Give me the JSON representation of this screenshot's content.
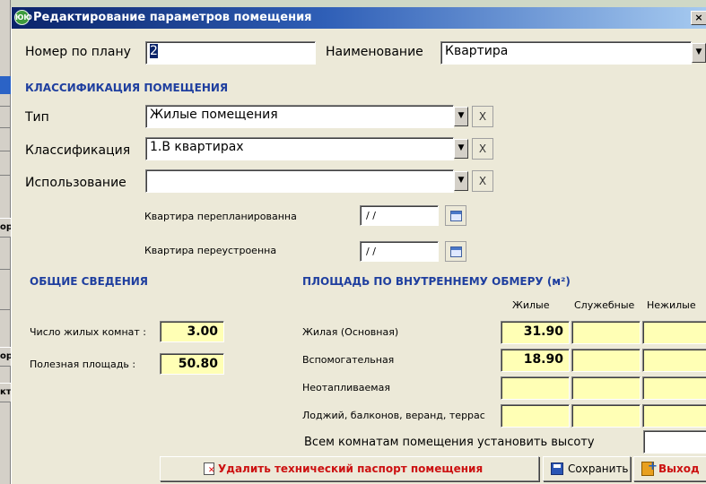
{
  "window": {
    "title": "Редактирование параметров помещения",
    "icon_text": "ЮЮ",
    "close_label": "×"
  },
  "left_fragments": [
    "ор",
    "ор",
    "кт"
  ],
  "plan_number": {
    "label": "Номер по плану",
    "value": "2"
  },
  "name": {
    "label": "Наименование",
    "value": "Квартира"
  },
  "classification_section": {
    "title": "КЛАССИФИКАЦИЯ ПОМЕЩЕНИЯ",
    "type": {
      "label": "Тип",
      "value": "Жилые помещения"
    },
    "classification": {
      "label": "Классификация",
      "value": "1.В квартирах"
    },
    "usage": {
      "label": "Использование",
      "value": ""
    },
    "clear_label": "X",
    "replanned": {
      "label": "Квартира перепланированна",
      "value": "/ /"
    },
    "rebuilt": {
      "label": "Квартира переустроенна",
      "value": "/ /"
    }
  },
  "general_section": {
    "title": "ОБЩИЕ СВЕДЕНИЯ",
    "rooms": {
      "label": "Число жилых комнат :",
      "value": "3.00"
    },
    "useful_area": {
      "label": "Полезная площадь :",
      "value": "50.80"
    }
  },
  "area_section": {
    "title": "ПЛОЩАДЬ ПО ВНУТРЕННЕМУ ОБМЕРУ (м²)",
    "columns": [
      "Жилые",
      "Служебные",
      "Нежилые"
    ],
    "rows": [
      {
        "label": "Жилая (Основная)",
        "values": [
          "31.90",
          "",
          ""
        ]
      },
      {
        "label": "Вспомогательная",
        "values": [
          "18.90",
          "",
          ""
        ]
      },
      {
        "label": "Неотапливаемая",
        "values": [
          "",
          "",
          ""
        ]
      },
      {
        "label": "Лоджий, балконов, веранд, террас",
        "values": [
          "",
          "",
          ""
        ]
      }
    ],
    "height_label": "Всем комнатам помещения установить высоту"
  },
  "buttons": {
    "delete": "Удалить технический паспорт помещения",
    "save": "Сохранить",
    "exit": "Выход"
  }
}
